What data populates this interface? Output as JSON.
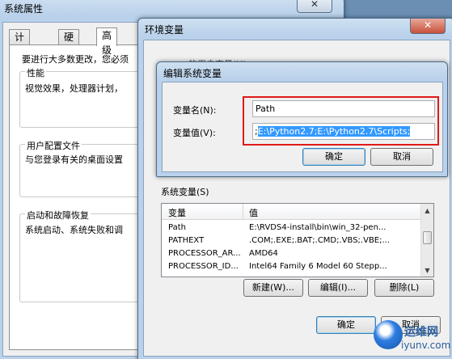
{
  "sysprops": {
    "title": "系统属性",
    "tabs": [
      "计算机名",
      "硬件",
      "高级"
    ],
    "admin_note": "要进行大多数更改，您必须",
    "performance": {
      "label": "性能",
      "desc": "视觉效果，处理器计划，"
    },
    "profiles": {
      "label": "用户配置文件",
      "desc": "与您登录有关的桌面设置"
    },
    "startup": {
      "label": "启动和故障恢复",
      "desc": "系统启动、系统失败和调"
    }
  },
  "envvars": {
    "title": "环境变量",
    "user_vars_label": "的用户变量(U)",
    "sys_vars_label": "系统变量(S)",
    "columns": [
      "变量",
      "值"
    ],
    "rows": [
      {
        "name": "Path",
        "value": "E:\\RVDS4-install\\bin\\win_32-pen..."
      },
      {
        "name": "PATHEXT",
        "value": ".COM;.EXE;.BAT;.CMD;.VBS;.VBE;..."
      },
      {
        "name": "PROCESSOR_AR...",
        "value": "AMD64"
      },
      {
        "name": "PROCESSOR_ID...",
        "value": "Intel64 Family 6 Model 60 Stepp..."
      }
    ],
    "new_btn": "新建(W)...",
    "edit_btn": "编辑(I)...",
    "delete_btn": "删除(L)",
    "ok_btn": "确定",
    "cancel_btn": "取消"
  },
  "editvar": {
    "title": "编辑系统变量",
    "name_label": "变量名(N):",
    "name_value": "Path",
    "value_label": "变量值(V):",
    "value_prefix": ";",
    "value_selected": "E:\\Python2.7;E:\\Python2.7\\Scripts;",
    "ok_btn": "确定",
    "cancel_btn": "取消"
  },
  "watermark": {
    "line1": "运维网",
    "line2": "iyunv.com"
  },
  "colors": {
    "highlight": "#e11919",
    "selection": "#3399ff"
  }
}
